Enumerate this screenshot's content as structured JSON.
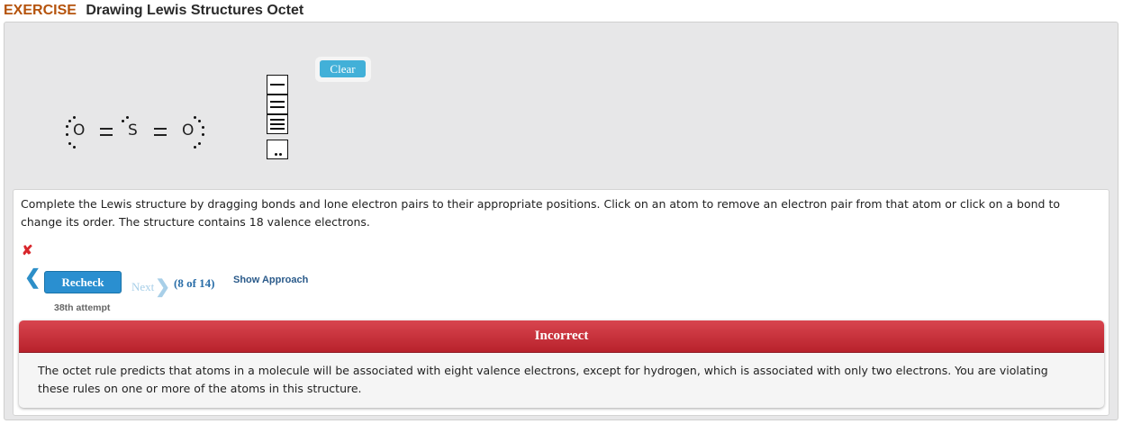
{
  "header": {
    "exercise_label": "EXERCISE",
    "title": "Drawing Lewis Structures Octet"
  },
  "canvas": {
    "clear_label": "Clear",
    "molecule": {
      "left_atom": "O",
      "center_atom": "S",
      "right_atom": "O",
      "left_bond": "double",
      "right_bond": "double"
    },
    "palette": [
      "single-bond-icon",
      "double-bond-icon",
      "triple-bond-icon",
      "lone-pair-icon"
    ]
  },
  "question": {
    "instructions": "Complete the Lewis structure by dragging bonds and lone electron pairs to their appropriate positions. Click on an atom to remove an electron pair from that atom or click on a bond to change its order. The structure contains 18 valence electrons.",
    "status_icon": "x-mark",
    "recheck_label": "Recheck",
    "next_label": "Next",
    "progress": "(8 of 14)",
    "show_approach_label": "Show Approach",
    "attempt": "38th attempt"
  },
  "feedback": {
    "title": "Incorrect",
    "message": "The octet rule predicts that atoms in a molecule will be associated with eight valence electrons, except for hydrogen, which is associated with only two electrons. You are violating these rules on one or more of the atoms in this structure."
  },
  "colors": {
    "exercise_label": "#b5530c",
    "clear_button": "#42b0d8",
    "recheck_button": "#2a8fd0",
    "incorrect_banner": "#c8303a",
    "error_mark": "#d8262b"
  }
}
